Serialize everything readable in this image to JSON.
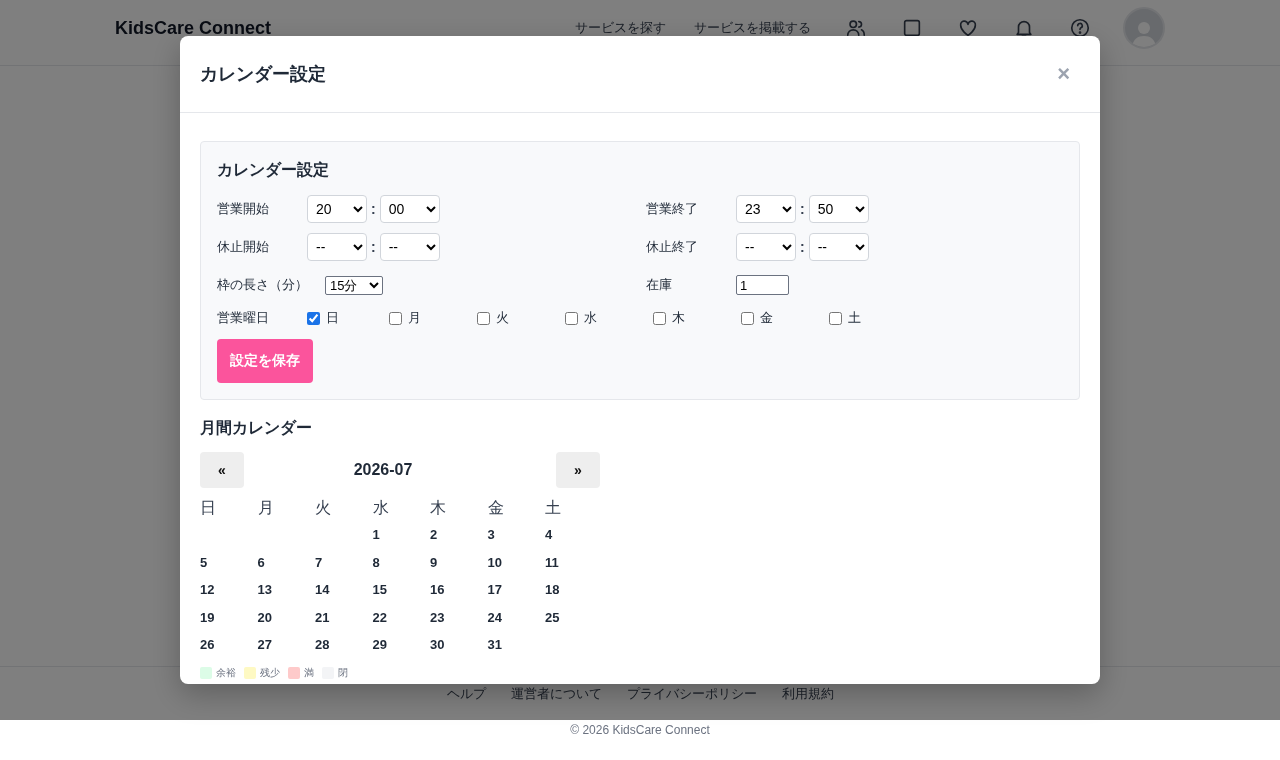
{
  "header": {
    "logo": "KidsCare Connect",
    "nav_links": [
      "サービスを探す",
      "サービスを掲載する"
    ]
  },
  "modal": {
    "title": "カレンダー設定",
    "close": "×",
    "settings": {
      "heading": "カレンダー設定",
      "time_rows": [
        {
          "label": "営業開始",
          "hour": "20",
          "separator": ":",
          "minute": "00"
        },
        {
          "label": "営業終了",
          "hour": "23",
          "separator": ":",
          "minute": "50"
        },
        {
          "label": "休止開始",
          "hour": "--",
          "separator": ":",
          "minute": "--"
        },
        {
          "label": "休止終了",
          "hour": "--",
          "separator": ":",
          "minute": "--"
        }
      ],
      "slot_length": {
        "label": "枠の長さ（分）",
        "value": "15分"
      },
      "stock": {
        "label": "在庫",
        "value": "1"
      },
      "days": {
        "label": "営業曜日",
        "items": [
          {
            "label": "日",
            "checked": true
          },
          {
            "label": "月",
            "checked": false
          },
          {
            "label": "火",
            "checked": false
          },
          {
            "label": "水",
            "checked": false
          },
          {
            "label": "木",
            "checked": false
          },
          {
            "label": "金",
            "checked": false
          },
          {
            "label": "土",
            "checked": false
          }
        ]
      },
      "save_button": "設定を保存"
    },
    "calendar": {
      "heading": "月間カレンダー",
      "prev": "«",
      "month": "2026-07",
      "next": "»",
      "weekdays": [
        "日",
        "月",
        "火",
        "水",
        "木",
        "金",
        "土"
      ],
      "weeks": [
        [
          "1",
          "2",
          "3",
          "4"
        ],
        [
          "5",
          "6",
          "7",
          "8",
          "9",
          "10",
          "11"
        ],
        [
          "12",
          "13",
          "14",
          "15",
          "16",
          "17",
          "18"
        ],
        [
          "19",
          "20",
          "21",
          "22",
          "23",
          "24",
          "25"
        ],
        [
          "26",
          "27",
          "28",
          "29",
          "30",
          "31"
        ]
      ],
      "legend": [
        {
          "label": "余裕",
          "color": "#dcfce7"
        },
        {
          "label": "残少",
          "color": "#fef9c3"
        },
        {
          "label": "満",
          "color": "#fecaca"
        },
        {
          "label": "閉",
          "color": "#f3f4f6"
        }
      ]
    }
  },
  "footer": {
    "links": [
      "ヘルプ",
      "運営者について",
      "プライバシーポリシー",
      "利用規約"
    ],
    "copyright": "© 2026 KidsCare Connect"
  }
}
